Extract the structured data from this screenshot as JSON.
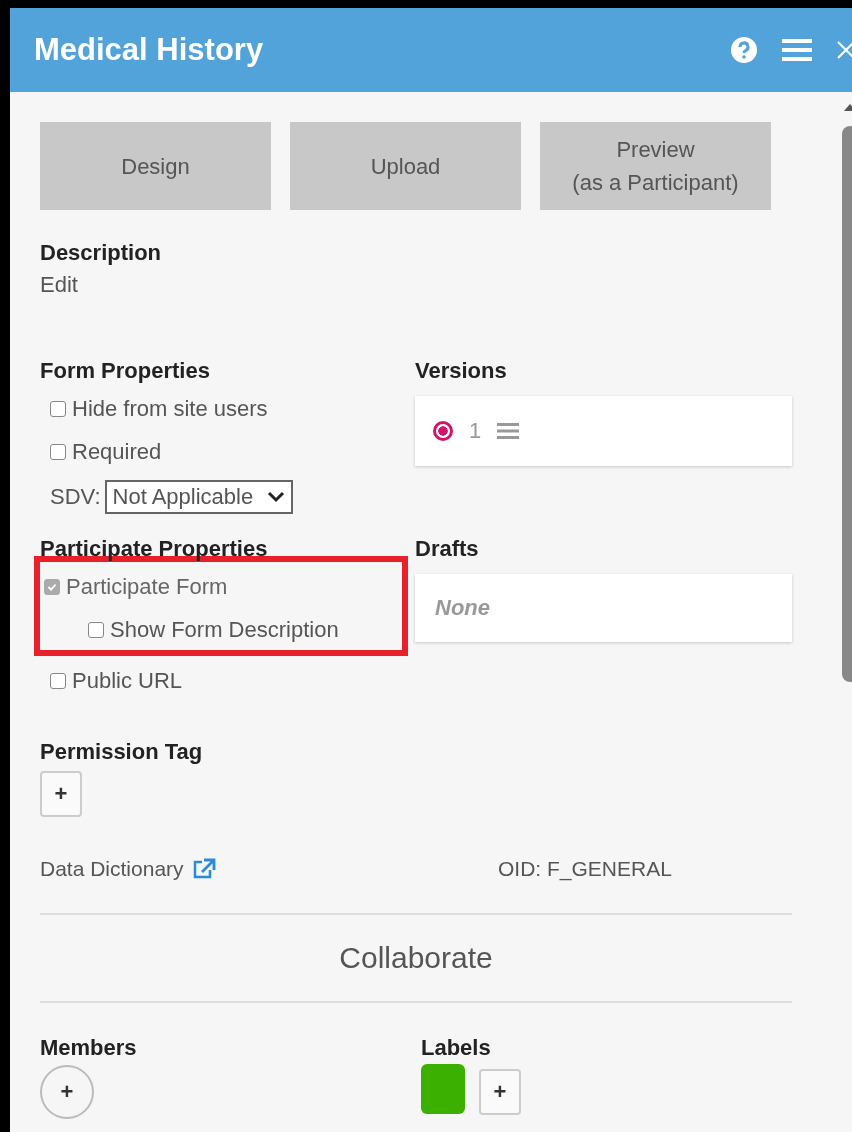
{
  "window": {
    "title": "Medical History"
  },
  "actions": [
    {
      "label": "Design"
    },
    {
      "label": "Upload"
    },
    {
      "label": "Preview\n(as a Participant)"
    }
  ],
  "description": {
    "title": "Description",
    "link": "Edit"
  },
  "form_properties": {
    "title": "Form Properties",
    "items": [
      {
        "label": "Hide from site users",
        "checked": false
      },
      {
        "label": "Required",
        "checked": false
      }
    ],
    "sdv": {
      "label": "SDV:",
      "value": "Not Applicable"
    }
  },
  "participate_properties": {
    "title": "Participate Properties",
    "items": [
      {
        "label": "Participate Form",
        "checked": true,
        "disabled": true,
        "highlighted": true,
        "children": [
          {
            "label": "Show Form Description",
            "checked": false,
            "disabled": false
          }
        ]
      },
      {
        "label": "Public URL",
        "checked": false,
        "disabled": false,
        "highlighted": false
      }
    ]
  },
  "versions": {
    "title": "Versions",
    "items": [
      {
        "label": "1",
        "selected": true
      }
    ]
  },
  "drafts": {
    "title": "Drafts",
    "empty_text": "None"
  },
  "permission_tag": {
    "title": "Permission Tag",
    "add_button": "+"
  },
  "data_dictionary": {
    "label": "Data Dictionary"
  },
  "oid": "OID: F_GENERAL",
  "collaborate": {
    "title": "Collaborate"
  },
  "members": {
    "title": "Members",
    "add_button": "+"
  },
  "labels": {
    "title": "Labels",
    "items": [
      {
        "color": "#3cb000"
      }
    ],
    "add_button": "+"
  }
}
